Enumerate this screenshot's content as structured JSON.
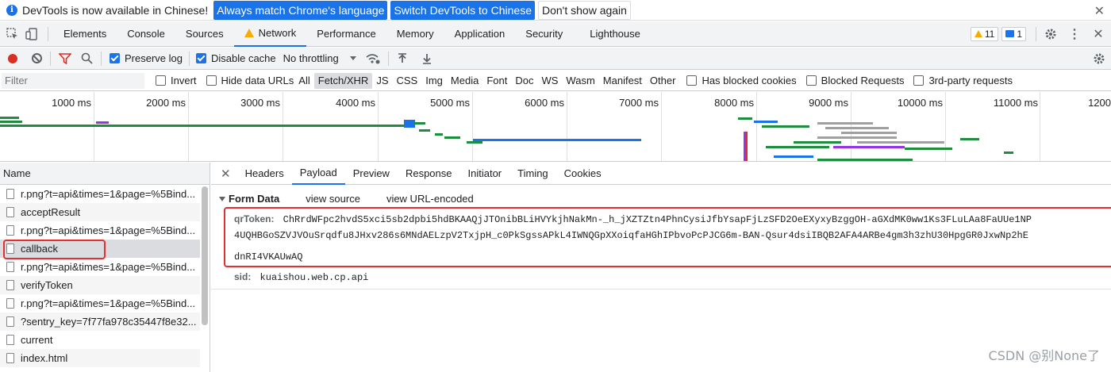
{
  "infobar": {
    "message": "DevTools is now available in Chinese!",
    "btn_match": "Always match Chrome's language",
    "btn_switch": "Switch DevTools to Chinese",
    "btn_dismiss": "Don't show again"
  },
  "tabs": {
    "elements": "Elements",
    "console": "Console",
    "sources": "Sources",
    "network": "Network",
    "performance": "Performance",
    "memory": "Memory",
    "application": "Application",
    "security": "Security",
    "lighthouse": "Lighthouse",
    "warnings_count": "11",
    "messages_count": "1"
  },
  "toolbar": {
    "preserve_log": "Preserve log",
    "disable_cache": "Disable cache",
    "throttling": "No throttling"
  },
  "filter": {
    "placeholder": "Filter",
    "invert": "Invert",
    "hide_data_urls": "Hide data URLs",
    "types": [
      "All",
      "Fetch/XHR",
      "JS",
      "CSS",
      "Img",
      "Media",
      "Font",
      "Doc",
      "WS",
      "Wasm",
      "Manifest",
      "Other"
    ],
    "active_type": "Fetch/XHR",
    "blocked_cookies": "Has blocked cookies",
    "blocked_requests": "Blocked Requests",
    "third_party": "3rd-party requests"
  },
  "overview": {
    "ticks": [
      "1000 ms",
      "2000 ms",
      "3000 ms",
      "4000 ms",
      "5000 ms",
      "6000 ms",
      "7000 ms",
      "8000 ms",
      "9000 ms",
      "10000 ms",
      "11000 ms",
      "1200"
    ]
  },
  "requests": {
    "header": "Name",
    "rows": [
      "r.png?t=api&times=1&page=%5Bind...",
      "acceptResult",
      "r.png?t=api&times=1&page=%5Bind...",
      "callback",
      "r.png?t=api&times=1&page=%5Bind...",
      "verifyToken",
      "r.png?t=api&times=1&page=%5Bind...",
      "?sentry_key=7f77fa978c35447f8e32...",
      "current",
      "index.html"
    ]
  },
  "details": {
    "tabs": [
      "Headers",
      "Payload",
      "Preview",
      "Response",
      "Initiator",
      "Timing",
      "Cookies"
    ],
    "active_tab": "Payload",
    "section_title": "Form Data",
    "view_source": "view source",
    "view_url_encoded": "view URL-encoded",
    "qr_key": "qrToken:",
    "qr_line1": "ChRrdWFpc2hvdS5xci5sb2dpbi5hdBKAAQjJTOnibBLiHVYkjhNakMn-_h_jXZTZtn4PhnCysiJfbYsapFjLzSFD2OeEXyxyBzggOH-aGXdMK0ww1Ks3FLuLAa8FaUUe1NP",
    "qr_line2": "4UQHBGoSZVJVOuSrqdfu8JHxv286s6MNdAELzpV2TxjpH_c0PkSgssAPkL4IWNQGpXXoiqfaHGhIPbvoPcPJCG6m-BAN-Qsur4dsiIBQB2AFA4ARBe4gm3h3zhU30HpgGR0JxwNp2hE",
    "qr_line3": "dnRI4VKAUwAQ",
    "sid_key": "sid:",
    "sid_value": "kuaishou.web.cp.api"
  },
  "watermark": "CSDN @别None了"
}
